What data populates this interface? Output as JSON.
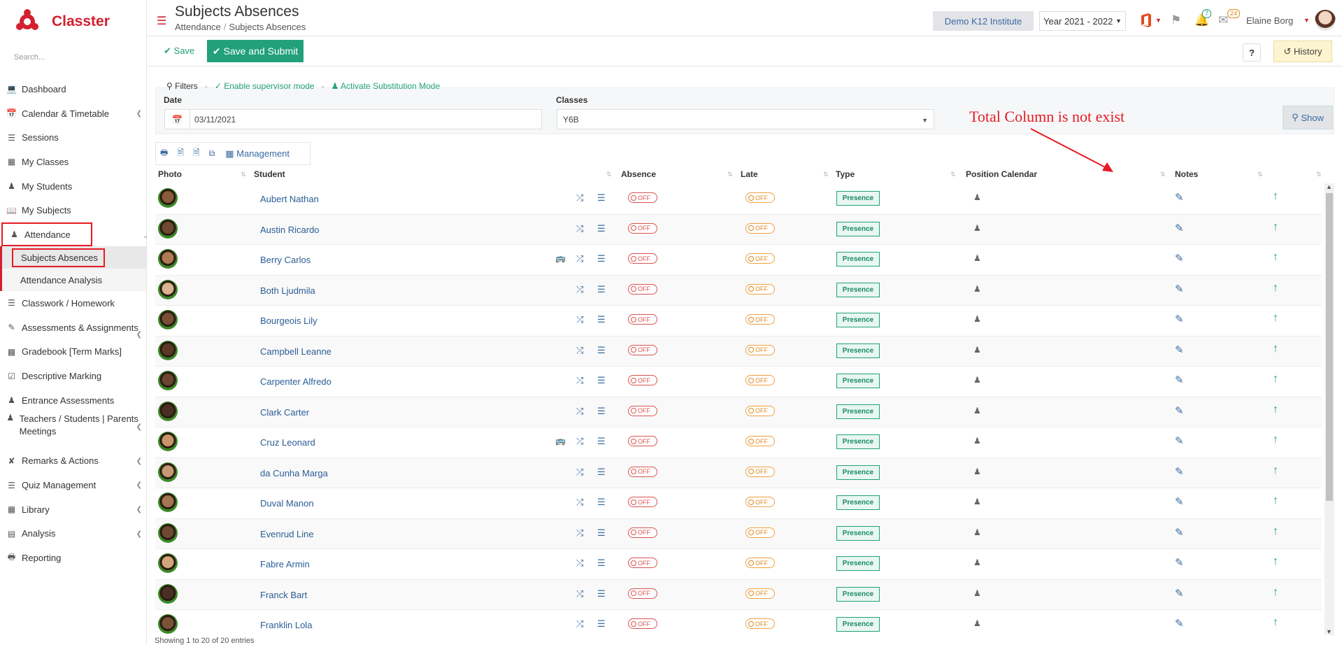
{
  "app": {
    "logo_text": "Classter",
    "search_placeholder": "Search..."
  },
  "sidebar": {
    "items": [
      {
        "label": "Dashboard",
        "icon": "laptop-icon",
        "chev": false
      },
      {
        "label": "Calendar & Timetable",
        "icon": "calendar-icon",
        "chev": true
      },
      {
        "label": "Sessions",
        "icon": "sessions-icon",
        "chev": false
      },
      {
        "label": "My Classes",
        "icon": "classes-icon",
        "chev": false
      },
      {
        "label": "My Students",
        "icon": "students-icon",
        "chev": false
      },
      {
        "label": "My Subjects",
        "icon": "book-icon",
        "chev": false
      }
    ],
    "attendance": {
      "label": "Attendance",
      "sub": [
        "Subjects Absences",
        "Attendance Analysis"
      ]
    },
    "items2": [
      {
        "label": "Classwork / Homework",
        "icon": "tasks-icon",
        "chev": false
      },
      {
        "label": "Assessments & Assignments",
        "icon": "pencil-icon",
        "chev": true
      },
      {
        "label": "Gradebook [Term Marks]",
        "icon": "gradebook-icon",
        "chev": false
      },
      {
        "label": "Descriptive Marking",
        "icon": "marking-icon",
        "chev": false
      },
      {
        "label": "Entrance Assessments",
        "icon": "entrance-icon",
        "chev": false
      },
      {
        "label": "Teachers / Students | Parents Meetings",
        "icon": "meetings-icon",
        "chev": true
      },
      {
        "label": "Remarks & Actions",
        "icon": "remarks-icon",
        "chev": true
      },
      {
        "label": "Quiz Management",
        "icon": "quiz-icon",
        "chev": true
      },
      {
        "label": "Library",
        "icon": "library-icon",
        "chev": true
      },
      {
        "label": "Analysis",
        "icon": "analysis-icon",
        "chev": true
      },
      {
        "label": "Reporting",
        "icon": "printer-icon",
        "chev": false
      }
    ]
  },
  "header": {
    "title": "Subjects Absences",
    "breadcrumb": [
      "Attendance",
      "Subjects Absences"
    ],
    "institute": "Demo K12 Institute",
    "year": "Year 2021 - 2022",
    "notif_count": "7",
    "mail_count": "24",
    "user": "Elaine Borg"
  },
  "toolbar": {
    "save": "Save",
    "save_submit": "Save and Submit",
    "help": "?",
    "history": "History"
  },
  "filters": {
    "title": "Filters",
    "supervisor": "Enable supervisor mode",
    "substitution": "Activate Substitution Mode",
    "date_label": "Date",
    "date_value": "03/11/2021",
    "classes_label": "Classes",
    "classes_value": "Y6B",
    "show": "Show"
  },
  "annotation": "Total Column is not exist",
  "actions": {
    "management": "Management"
  },
  "table": {
    "headers": {
      "photo": "Photo",
      "student": "Student",
      "absence": "Absence",
      "late": "Late",
      "type": "Type",
      "position": "Position Calendar",
      "notes": "Notes"
    },
    "off": "OFF",
    "presence": "Presence",
    "rows": [
      {
        "name": "Aubert Nathan",
        "bus": false,
        "skin": "#8a5a3c"
      },
      {
        "name": "Austin Ricardo",
        "bus": false,
        "skin": "#6d4a32"
      },
      {
        "name": "Berry Carlos",
        "bus": true,
        "skin": "#b07a52"
      },
      {
        "name": "Both Ljudmila",
        "bus": false,
        "skin": "#d9b48f"
      },
      {
        "name": "Bourgeois Lily",
        "bus": false,
        "skin": "#7a4f35"
      },
      {
        "name": "Campbell Leanne",
        "bus": false,
        "skin": "#5a3a26"
      },
      {
        "name": "Carpenter Alfredo",
        "bus": false,
        "skin": "#6b4630"
      },
      {
        "name": "Clark Carter",
        "bus": false,
        "skin": "#4a3024"
      },
      {
        "name": "Cruz Leonard",
        "bus": true,
        "skin": "#c9966c"
      },
      {
        "name": "da Cunha Marga",
        "bus": false,
        "skin": "#c59a74"
      },
      {
        "name": "Duval Manon",
        "bus": false,
        "skin": "#a67552"
      },
      {
        "name": "Evenrud Line",
        "bus": false,
        "skin": "#6d4a32"
      },
      {
        "name": "Fabre Armin",
        "bus": false,
        "skin": "#d2a67c"
      },
      {
        "name": "Franck Bart",
        "bus": false,
        "skin": "#4a3024"
      },
      {
        "name": "Franklin Lola",
        "bus": false,
        "skin": "#7a5238"
      }
    ]
  },
  "footer": "Showing 1 to 20 of 20 entries",
  "colors": {
    "brand": "#d32030",
    "green": "#22a07a",
    "link": "#2a5d96",
    "annotation": "#e61b23"
  }
}
